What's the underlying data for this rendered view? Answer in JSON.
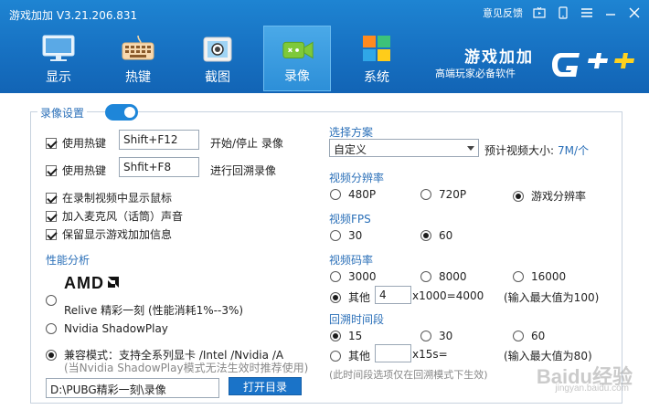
{
  "window": {
    "title": "游戏加加  V3.21.206.831",
    "feedback": "意见反馈"
  },
  "tabs": [
    {
      "label": "显示",
      "icon": "monitor-icon"
    },
    {
      "label": "热键",
      "icon": "keyboard-icon"
    },
    {
      "label": "截图",
      "icon": "camera-icon"
    },
    {
      "label": "录像",
      "icon": "video-camera-icon",
      "active": true
    },
    {
      "label": "系统",
      "icon": "grid-icon"
    }
  ],
  "brand": {
    "title": "游戏加加",
    "slogan": "高端玩家必备软件",
    "logo_text": "G++"
  },
  "colors": {
    "header": "#1771c2",
    "accent": "#1a73c8",
    "section": "#2a6fb8"
  },
  "record": {
    "section": "录像设置",
    "toggle_on": true,
    "hotkey_label": "使用热键",
    "hotkey1": {
      "value": "Shift+F12",
      "desc": "开始/停止 录像",
      "checked": true
    },
    "hotkey2": {
      "value": "Shfit+F8",
      "desc": "进行回溯录像",
      "checked": true
    },
    "opt_mouse": "在录制视频中显示鼠标",
    "opt_mic": "加入麦克风（话筒）声音",
    "opt_info": "保留显示游戏加加信息"
  },
  "perf": {
    "section": "性能分析",
    "amd_logo": "AMD",
    "relive": "Relive 精彩一刻 (性能消耗1%--3%)",
    "nvidia": "Nvidia ShadowPlay",
    "compat": "兼容模式：支持全系列显卡 /Intel /Nvidia /A",
    "compat_note": "(当Nvidia ShadowPlay模式无法生效时推荐使用)",
    "path": "D:\\PUBG精彩一刻\\录像",
    "open_dir": "打开目录"
  },
  "right": {
    "scheme_label": "选择方案",
    "scheme_value": "自定义",
    "estimate_label": "预计视频大小:",
    "estimate_value": "7M/个",
    "res_label": "视频分辨率",
    "res_options": [
      "480P",
      "720P",
      "游戏分辨率"
    ],
    "fps_label": "视频FPS",
    "fps_options": [
      "30",
      "60"
    ],
    "bitrate_label": "视频码率",
    "bitrate_options": [
      "3000",
      "8000",
      "16000"
    ],
    "bitrate_other": "其他",
    "bitrate_other_value": "4",
    "bitrate_formula": "x1000=4000",
    "bitrate_hint": "(输入最大值为100)",
    "rewind_label": "回溯时间段",
    "rewind_options": [
      "15",
      "30",
      "60"
    ],
    "rewind_other": "其他",
    "rewind_other_value": "",
    "rewind_formula": "x15s=",
    "rewind_hint": "(输入最大值为80)",
    "rewind_note": "(此时间段选项仅在回溯模式下生效)"
  },
  "watermark": {
    "text": "Baidu经验",
    "sub": "jingyan.baidu.com"
  }
}
